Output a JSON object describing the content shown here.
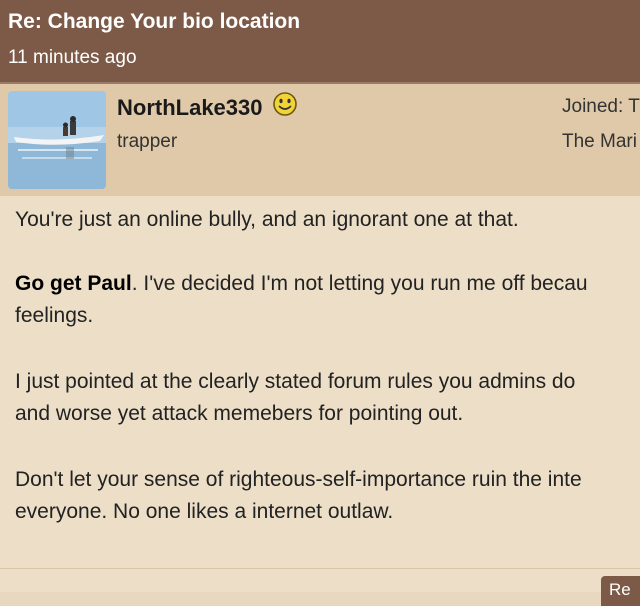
{
  "post": {
    "title": "Re: Change Your bio location",
    "time": "11 minutes ago"
  },
  "user": {
    "name": "NorthLake330",
    "rank": "trapper",
    "joined": "Joined: T",
    "location": "The Mari",
    "avatar_icon": "canoe-photo",
    "status_icon": "smiley-icon"
  },
  "body": {
    "p1": "You're just an online bully, and an ignorant one at that.",
    "p2_bold": "Go get Paul",
    "p2_rest": ". I've decided I'm not letting you run me off becau",
    "p2_line2": "feelings.",
    "p3_line1": "I just pointed at the clearly stated forum rules you admins do",
    "p3_line2": "and worse yet attack memebers for pointing out.",
    "p4_line1": "Don't let your sense of righteous-self-importance ruin the inte",
    "p4_line2": "everyone. No one likes a internet outlaw."
  },
  "footer": {
    "button_label": "Re"
  },
  "colors": {
    "header": "#7d5a47",
    "userbar": "#dfc9a9",
    "body": "#ecdec7"
  }
}
